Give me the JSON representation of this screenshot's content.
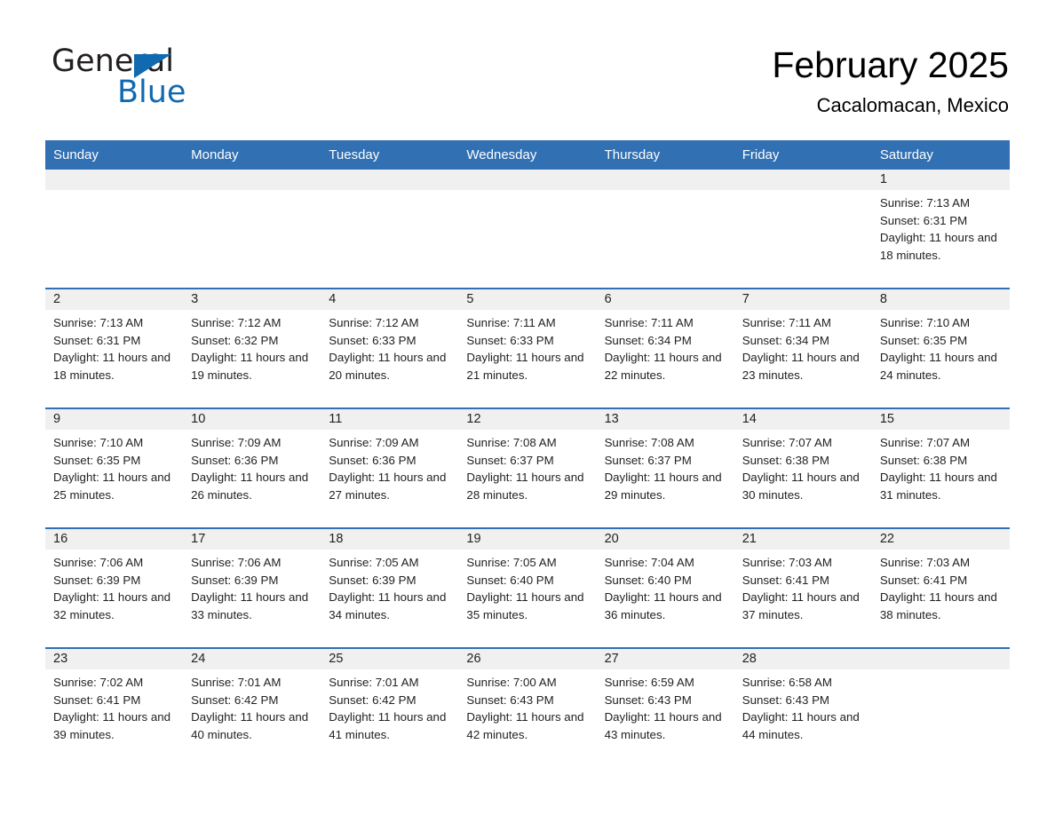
{
  "brand": {
    "name_part1": "General",
    "name_part2": "Blue",
    "triangle_color": "#1169b0",
    "text_color": "#231f20"
  },
  "header": {
    "title": "February 2025",
    "subtitle": "Cacalomacan, Mexico"
  },
  "theme": {
    "header_blue": "#3070b3",
    "daynum_gray": "#f0f0f0",
    "cell_white": "#ffffff"
  },
  "weekday_headers": [
    "Sunday",
    "Monday",
    "Tuesday",
    "Wednesday",
    "Thursday",
    "Friday",
    "Saturday"
  ],
  "weeks": [
    [
      {
        "day": "",
        "sunrise": "",
        "sunset": "",
        "daylight": "",
        "blank": true
      },
      {
        "day": "",
        "sunrise": "",
        "sunset": "",
        "daylight": "",
        "blank": true
      },
      {
        "day": "",
        "sunrise": "",
        "sunset": "",
        "daylight": "",
        "blank": true
      },
      {
        "day": "",
        "sunrise": "",
        "sunset": "",
        "daylight": "",
        "blank": true
      },
      {
        "day": "",
        "sunrise": "",
        "sunset": "",
        "daylight": "",
        "blank": true
      },
      {
        "day": "",
        "sunrise": "",
        "sunset": "",
        "daylight": "",
        "blank": true
      },
      {
        "day": "1",
        "sunrise": "Sunrise: 7:13 AM",
        "sunset": "Sunset: 6:31 PM",
        "daylight": "Daylight: 11 hours and 18 minutes.",
        "blank": false
      }
    ],
    [
      {
        "day": "2",
        "sunrise": "Sunrise: 7:13 AM",
        "sunset": "Sunset: 6:31 PM",
        "daylight": "Daylight: 11 hours and 18 minutes.",
        "blank": false
      },
      {
        "day": "3",
        "sunrise": "Sunrise: 7:12 AM",
        "sunset": "Sunset: 6:32 PM",
        "daylight": "Daylight: 11 hours and 19 minutes.",
        "blank": false
      },
      {
        "day": "4",
        "sunrise": "Sunrise: 7:12 AM",
        "sunset": "Sunset: 6:33 PM",
        "daylight": "Daylight: 11 hours and 20 minutes.",
        "blank": false
      },
      {
        "day": "5",
        "sunrise": "Sunrise: 7:11 AM",
        "sunset": "Sunset: 6:33 PM",
        "daylight": "Daylight: 11 hours and 21 minutes.",
        "blank": false
      },
      {
        "day": "6",
        "sunrise": "Sunrise: 7:11 AM",
        "sunset": "Sunset: 6:34 PM",
        "daylight": "Daylight: 11 hours and 22 minutes.",
        "blank": false
      },
      {
        "day": "7",
        "sunrise": "Sunrise: 7:11 AM",
        "sunset": "Sunset: 6:34 PM",
        "daylight": "Daylight: 11 hours and 23 minutes.",
        "blank": false
      },
      {
        "day": "8",
        "sunrise": "Sunrise: 7:10 AM",
        "sunset": "Sunset: 6:35 PM",
        "daylight": "Daylight: 11 hours and 24 minutes.",
        "blank": false
      }
    ],
    [
      {
        "day": "9",
        "sunrise": "Sunrise: 7:10 AM",
        "sunset": "Sunset: 6:35 PM",
        "daylight": "Daylight: 11 hours and 25 minutes.",
        "blank": false
      },
      {
        "day": "10",
        "sunrise": "Sunrise: 7:09 AM",
        "sunset": "Sunset: 6:36 PM",
        "daylight": "Daylight: 11 hours and 26 minutes.",
        "blank": false
      },
      {
        "day": "11",
        "sunrise": "Sunrise: 7:09 AM",
        "sunset": "Sunset: 6:36 PM",
        "daylight": "Daylight: 11 hours and 27 minutes.",
        "blank": false
      },
      {
        "day": "12",
        "sunrise": "Sunrise: 7:08 AM",
        "sunset": "Sunset: 6:37 PM",
        "daylight": "Daylight: 11 hours and 28 minutes.",
        "blank": false
      },
      {
        "day": "13",
        "sunrise": "Sunrise: 7:08 AM",
        "sunset": "Sunset: 6:37 PM",
        "daylight": "Daylight: 11 hours and 29 minutes.",
        "blank": false
      },
      {
        "day": "14",
        "sunrise": "Sunrise: 7:07 AM",
        "sunset": "Sunset: 6:38 PM",
        "daylight": "Daylight: 11 hours and 30 minutes.",
        "blank": false
      },
      {
        "day": "15",
        "sunrise": "Sunrise: 7:07 AM",
        "sunset": "Sunset: 6:38 PM",
        "daylight": "Daylight: 11 hours and 31 minutes.",
        "blank": false
      }
    ],
    [
      {
        "day": "16",
        "sunrise": "Sunrise: 7:06 AM",
        "sunset": "Sunset: 6:39 PM",
        "daylight": "Daylight: 11 hours and 32 minutes.",
        "blank": false
      },
      {
        "day": "17",
        "sunrise": "Sunrise: 7:06 AM",
        "sunset": "Sunset: 6:39 PM",
        "daylight": "Daylight: 11 hours and 33 minutes.",
        "blank": false
      },
      {
        "day": "18",
        "sunrise": "Sunrise: 7:05 AM",
        "sunset": "Sunset: 6:39 PM",
        "daylight": "Daylight: 11 hours and 34 minutes.",
        "blank": false
      },
      {
        "day": "19",
        "sunrise": "Sunrise: 7:05 AM",
        "sunset": "Sunset: 6:40 PM",
        "daylight": "Daylight: 11 hours and 35 minutes.",
        "blank": false
      },
      {
        "day": "20",
        "sunrise": "Sunrise: 7:04 AM",
        "sunset": "Sunset: 6:40 PM",
        "daylight": "Daylight: 11 hours and 36 minutes.",
        "blank": false
      },
      {
        "day": "21",
        "sunrise": "Sunrise: 7:03 AM",
        "sunset": "Sunset: 6:41 PM",
        "daylight": "Daylight: 11 hours and 37 minutes.",
        "blank": false
      },
      {
        "day": "22",
        "sunrise": "Sunrise: 7:03 AM",
        "sunset": "Sunset: 6:41 PM",
        "daylight": "Daylight: 11 hours and 38 minutes.",
        "blank": false
      }
    ],
    [
      {
        "day": "23",
        "sunrise": "Sunrise: 7:02 AM",
        "sunset": "Sunset: 6:41 PM",
        "daylight": "Daylight: 11 hours and 39 minutes.",
        "blank": false
      },
      {
        "day": "24",
        "sunrise": "Sunrise: 7:01 AM",
        "sunset": "Sunset: 6:42 PM",
        "daylight": "Daylight: 11 hours and 40 minutes.",
        "blank": false
      },
      {
        "day": "25",
        "sunrise": "Sunrise: 7:01 AM",
        "sunset": "Sunset: 6:42 PM",
        "daylight": "Daylight: 11 hours and 41 minutes.",
        "blank": false
      },
      {
        "day": "26",
        "sunrise": "Sunrise: 7:00 AM",
        "sunset": "Sunset: 6:43 PM",
        "daylight": "Daylight: 11 hours and 42 minutes.",
        "blank": false
      },
      {
        "day": "27",
        "sunrise": "Sunrise: 6:59 AM",
        "sunset": "Sunset: 6:43 PM",
        "daylight": "Daylight: 11 hours and 43 minutes.",
        "blank": false
      },
      {
        "day": "28",
        "sunrise": "Sunrise: 6:58 AM",
        "sunset": "Sunset: 6:43 PM",
        "daylight": "Daylight: 11 hours and 44 minutes.",
        "blank": false
      },
      {
        "day": "",
        "sunrise": "",
        "sunset": "",
        "daylight": "",
        "blank": true
      }
    ]
  ]
}
